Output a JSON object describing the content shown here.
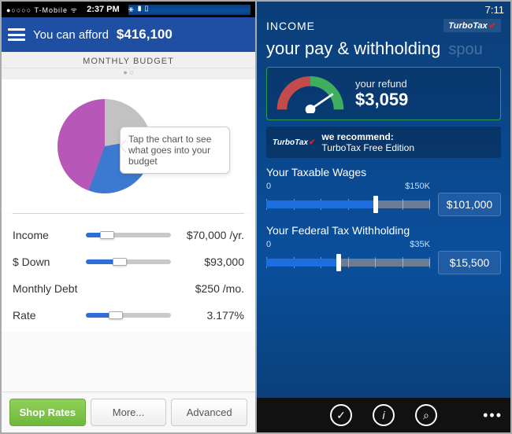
{
  "left": {
    "status": {
      "carrier": "T-Mobile",
      "time": "2:37 PM"
    },
    "header": {
      "prefix": "You can afford",
      "amount": "$416,100"
    },
    "section_title": "MONTHLY BUDGET",
    "tooltip": "Tap the chart to see what goes into your budget",
    "chart_data": {
      "type": "pie",
      "annotations": [
        "Tap the chart to see what goes into your budget"
      ],
      "series": [
        {
          "name": "Gray segment",
          "value": 22,
          "color": "#c2c2c2"
        },
        {
          "name": "Blue segment",
          "value": 33,
          "color": "#3b7ad0"
        },
        {
          "name": "Magenta segment",
          "value": 45,
          "color": "#b757b7"
        }
      ]
    },
    "sliders": [
      {
        "label": "Income",
        "value": "$70,000 /yr.",
        "pct": 25
      },
      {
        "label": "$ Down",
        "value": "$93,000",
        "pct": 40
      },
      {
        "label": "Monthly Debt",
        "value": "$250 /mo.",
        "pct": 0
      },
      {
        "label": "Rate",
        "value": "3.177%",
        "pct": 35
      }
    ],
    "buttons": {
      "shop": "Shop Rates",
      "more": "More...",
      "advanced": "Advanced"
    }
  },
  "right": {
    "status": {
      "time": "7:11"
    },
    "section": "INCOME",
    "logo": "TurboTax",
    "title": "your pay & withholding",
    "title_next": "spou",
    "refund": {
      "label": "your refund",
      "amount": "$3,059"
    },
    "recommend": {
      "line1": "we recommend:",
      "line2": "TurboTax Free Edition"
    },
    "wages": {
      "label": "Your Taxable Wages",
      "min": "0",
      "max": "$150K",
      "value": "$101,000",
      "pct": 67
    },
    "withholding": {
      "label": "Your Federal Tax Withholding",
      "min": "0",
      "max": "$35K",
      "value": "$15,500",
      "pct": 44
    }
  }
}
